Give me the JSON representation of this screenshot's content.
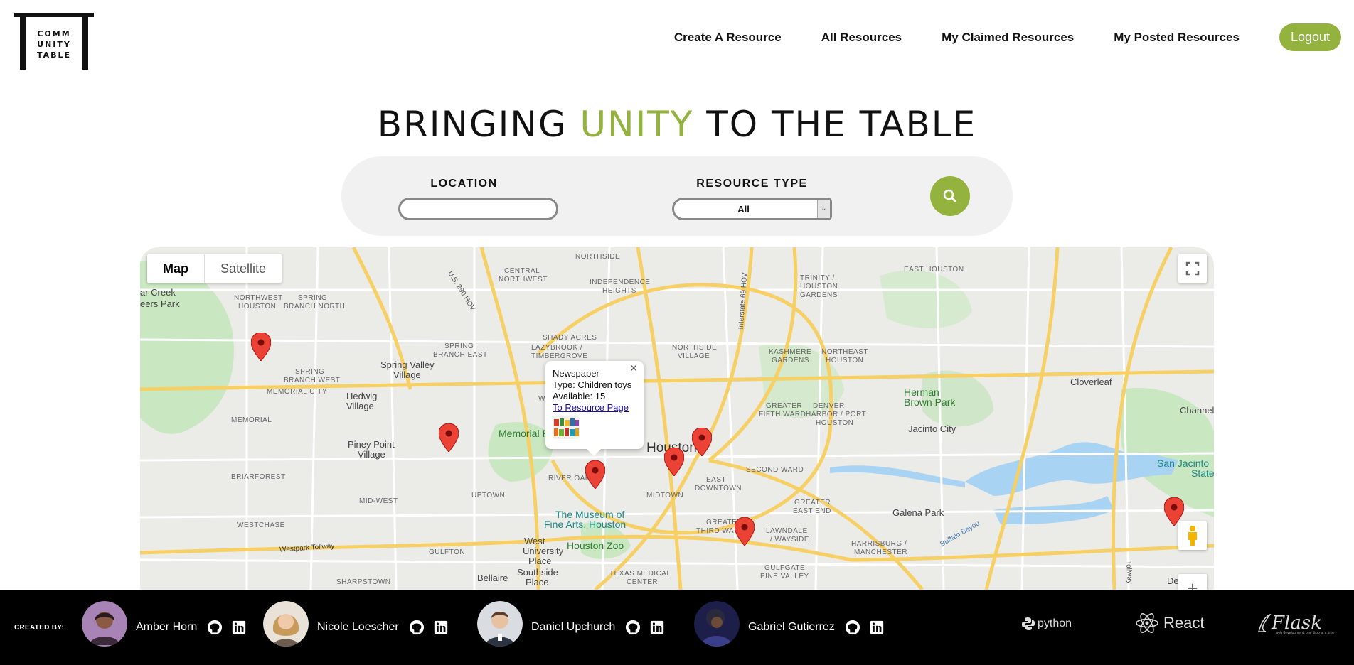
{
  "logo": {
    "lines": [
      "COMM",
      "UNITY",
      "TABLE"
    ]
  },
  "nav": {
    "items": [
      "Create A Resource",
      "All Resources",
      "My Claimed Resources",
      "My Posted Resources"
    ],
    "logout": "Logout"
  },
  "hero": {
    "part1": "BRINGING ",
    "accent": "UNITY",
    "part2": " TO THE TABLE"
  },
  "search": {
    "location_label": "LOCATION",
    "location_value": "",
    "type_label": "RESOURCE TYPE",
    "type_value": "All"
  },
  "map": {
    "type_controls": [
      "Map",
      "Satellite"
    ],
    "popup": {
      "title": "Newspaper",
      "type": "Type: Children toys",
      "available": "Available: 15",
      "link": "To Resource Page"
    },
    "places": {
      "houston": "Houston",
      "museum1": "The Museum of",
      "museum2": "Fine Arts, Houston",
      "zoo": "Houston Zoo",
      "memorial": "Memorial P",
      "hermanbrown1": "Herman",
      "hermanbrown2": "Brown Park",
      "sanjacinto1": "San Jacinto",
      "sanjacinto2": "State",
      "bearcreek1": "ar Creek",
      "bearcreek2": "eers Park",
      "springvalley1": "Spring Valley",
      "springvalley2": "Village",
      "hedwig1": "Hedwig",
      "hedwig2": "Village",
      "pineypoint1": "Piney Point",
      "pineypoint2": "Village",
      "cloverleaf": "Cloverleaf",
      "jacinto": "Jacinto City",
      "galena": "Galena Park",
      "channel": "Channel",
      "bellaire": "Bellaire",
      "westuni1": "West",
      "westuni2": "University",
      "westuni3": "Place",
      "southside1": "Southside",
      "southside2": "Place",
      "de": "De",
      "northside": "NORTHSIDE",
      "centralnw1": "CENTRAL",
      "centralnw2": "NORTHWEST",
      "indep1": "INDEPENDENCE",
      "indep2": "HEIGHTS",
      "nwhouston1": "NORTHWEST",
      "nwhouston2": "HOUSTON",
      "springbranchn1": "SPRING",
      "springbranchn2": "BRANCH NORTH",
      "shadyacres": "SHADY ACRES",
      "lazybrook1": "LAZYBROOK /",
      "lazybrook2": "TIMBERGROVE",
      "springbranche1": "SPRING",
      "springbranche2": "BRANCH EAST",
      "springbranchw1": "SPRING",
      "springbranchw2": "BRANCH WEST",
      "memorialcity": "MEMORIAL CITY",
      "memorialarea": "MEMORIAL",
      "briarforest": "BRIARFOREST",
      "midwest": "MID-WEST",
      "westchase": "WESTCHASE",
      "gulfton": "GULFTON",
      "sharpstown": "SHARPSTOWN",
      "uptown": "UPTOWN",
      "riveroaks": "RIVER OAKS",
      "midtown": "MIDTOWN",
      "eastdowntown1": "EAST",
      "eastdowntown2": "DOWNTOWN",
      "secondward": "SECOND WARD",
      "thirdward1": "GREATER",
      "thirdward2": "THIRD WARD",
      "greatereastend1": "GREATER",
      "greatereastend2": "EAST END",
      "lawndale1": "LAWNDALE",
      "lawndale2": "/ WAYSIDE",
      "harrisburg1": "HARRISBURG /",
      "harrisburg2": "MANCHESTER",
      "gulfgate1": "GULFGATE",
      "gulfgate2": "PINE VALLEY",
      "texasmed1": "TEXAS MEDICAL",
      "texasmed2": "CENTER",
      "fifthward1": "GREATER",
      "fifthward2": "FIFTH WARD",
      "denver1": "DENVER",
      "denver2": "HARBOR / PORT",
      "denver3": "HOUSTON",
      "northeast1": "NORTHEAST",
      "northeast2": "HOUSTON",
      "kashmere1": "KASHMERE",
      "kashmere2": "GARDENS",
      "trinity1": "TRINITY /",
      "trinity2": "HOUSTON",
      "trinity3": "GARDENS",
      "easthouston": "EAST HOUSTON",
      "nvillage1": "NORTHSIDE",
      "nvillage2": "VILLAGE",
      "washington": "WASHIN",
      "westpark": "Westpark Tollway",
      "hov290": "U.S. 290 HOV",
      "i69hov": "Interstate 69 HOV",
      "buffalo": "Buffalo Bayou",
      "tollway": "Tollway"
    }
  },
  "footer": {
    "created_by": "CREATED BY:",
    "people": [
      "Amber Horn",
      "Nicole Loescher",
      "Daniel Upchurch",
      "Gabriel Gutierrez"
    ],
    "tech": [
      "python",
      "React",
      "Flask"
    ],
    "flask_tagline": "web development, one drop at a time"
  },
  "colors": {
    "accent": "#93b33e",
    "marker": "#ea4335",
    "footer_bg": "#000000"
  }
}
